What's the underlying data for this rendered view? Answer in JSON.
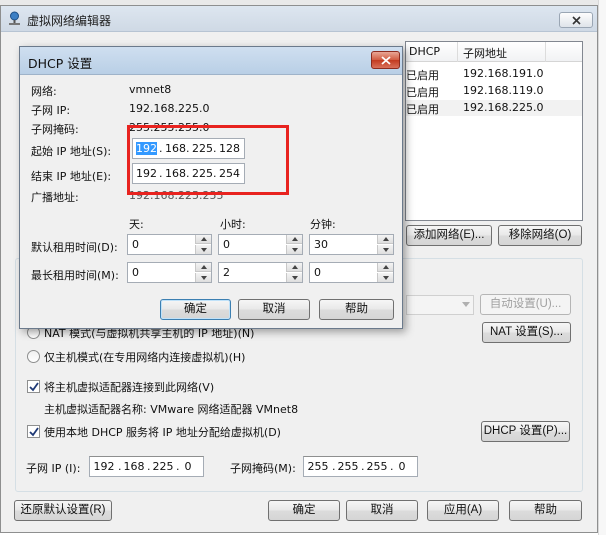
{
  "main_window": {
    "title": "虚拟网络编辑器",
    "network_table": {
      "columns": [
        "DHCP",
        "子网地址"
      ],
      "rows": [
        {
          "dhcp": "已启用",
          "subnet": "192.168.191.0"
        },
        {
          "dhcp": "已启用",
          "subnet": "192.168.119.0"
        },
        {
          "dhcp": "已启用",
          "subnet": "192.168.225.0"
        }
      ]
    },
    "add_network_label": "添加网络(E)...",
    "remove_network_label": "移除网络(O)",
    "auto_settings_label": "自动设置(U)...",
    "nat_mode_label": "NAT 模式(与虚拟机共享主机的 IP 地址)(N)",
    "nat_settings_label": "NAT 设置(S)...",
    "host_only_label": "仅主机模式(在专用网络内连接虚拟机)(H)",
    "connect_adapter_label": "将主机虚拟适配器连接到此网络(V)",
    "adapter_name_label": "主机虚拟适配器名称: VMware 网络适配器 VMnet8",
    "use_dhcp_label": "使用本地 DHCP 服务将 IP 地址分配给虚拟机(D)",
    "dhcp_settings_label": "DHCP 设置(P)...",
    "subnet_ip_label": "子网 IP (I):",
    "subnet_ip": [
      "192",
      "168",
      "225",
      "0"
    ],
    "subnet_mask_label": "子网掩码(M):",
    "subnet_mask": [
      "255",
      "255",
      "255",
      "0"
    ],
    "restore_defaults_label": "还原默认设置(R)",
    "ok_label": "确定",
    "cancel_label": "取消",
    "apply_label": "应用(A)",
    "help_label": "帮助"
  },
  "dhcp_dialog": {
    "title": "DHCP 设置",
    "network_label": "网络:",
    "network_value": "vmnet8",
    "subnet_ip_label": "子网 IP:",
    "subnet_ip_value": "192.168.225.0",
    "subnet_mask_label": "子网掩码:",
    "subnet_mask_value": "255.255.255.0",
    "start_ip_label": "起始 IP 地址(S):",
    "start_ip": [
      "192",
      "168",
      "225",
      "128"
    ],
    "end_ip_label": "结束 IP 地址(E):",
    "end_ip": [
      "192",
      "168",
      "225",
      "254"
    ],
    "broadcast_label": "广播地址:",
    "broadcast_value": "192.168.225.255",
    "days_header": "天:",
    "hours_header": "小时:",
    "minutes_header": "分钟:",
    "default_lease_label": "默认租用时间(D):",
    "default_lease": {
      "days": "0",
      "hours": "0",
      "minutes": "30"
    },
    "max_lease_label": "最长租用时间(M):",
    "max_lease": {
      "days": "0",
      "hours": "2",
      "minutes": "0"
    },
    "ok_label": "确定",
    "cancel_label": "取消",
    "help_label": "帮助"
  },
  "colors": {
    "highlight": "#e8231f",
    "selection": "#3399ff"
  },
  "icons": [
    "app-icon",
    "close-icon",
    "checkmark-icon",
    "dropdown-arrow-icon"
  ]
}
